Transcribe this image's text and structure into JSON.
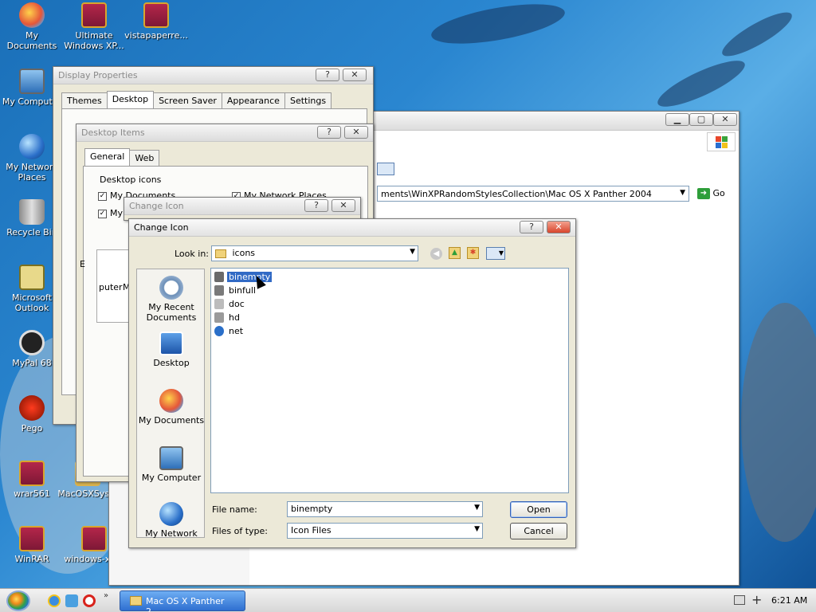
{
  "desktop": {
    "icons": [
      {
        "label": "My Documents",
        "icon": "apple-icon"
      },
      {
        "label": "Ultimate Windows XP...",
        "icon": "winrar-archive-icon"
      },
      {
        "label": "vistapaperre...",
        "icon": "winrar-archive-icon"
      },
      {
        "label": "My Computer",
        "icon": "monitor-icon"
      },
      {
        "label": "My Network Places",
        "icon": "globe-icon"
      },
      {
        "label": "Recycle Bin",
        "icon": "trash-icon"
      },
      {
        "label": "Microsoft Outlook",
        "icon": "outlook-icon"
      },
      {
        "label": "MyPal 68",
        "icon": "raccoon-icon"
      },
      {
        "label": "Pego",
        "icon": "pego-icon"
      },
      {
        "label": "wrar561",
        "icon": "winrar-archive-icon"
      },
      {
        "label": "MacOSXSys...",
        "icon": "folder-icon"
      },
      {
        "label": "WinRAR",
        "icon": "winrar-archive-icon"
      },
      {
        "label": "windows-xp...",
        "icon": "winrar-archive-icon"
      }
    ]
  },
  "explorer": {
    "address": "ments\\WinXPRandomStylesCollection\\Mac OS X Panther 2004",
    "go_label": "Go"
  },
  "display_properties": {
    "title": "Display Properties",
    "tabs": [
      "Themes",
      "Desktop",
      "Screen Saver",
      "Appearance",
      "Settings"
    ],
    "selected_tab": "Desktop"
  },
  "desktop_items": {
    "title": "Desktop Items",
    "tabs": [
      "General",
      "Web"
    ],
    "group_label": "Desktop icons",
    "checkboxes": [
      "My Documents",
      "My Network Places",
      "My"
    ],
    "partial_labels": [
      "E",
      "puter",
      "M"
    ]
  },
  "change_icon_bg": {
    "title": "Change Icon"
  },
  "change_icon": {
    "title": "Change Icon",
    "look_in_label": "Look in:",
    "look_in_value": "icons",
    "places": [
      "My Recent Documents",
      "Desktop",
      "My Documents",
      "My Computer",
      "My Network"
    ],
    "files": [
      {
        "name": "binempty",
        "selected": true,
        "color": "#6a6a6a"
      },
      {
        "name": "binfull",
        "selected": false,
        "color": "#7a7a7a"
      },
      {
        "name": "doc",
        "selected": false,
        "color": "#bcbcbc"
      },
      {
        "name": "hd",
        "selected": false,
        "color": "#9a9a9a"
      },
      {
        "name": "net",
        "selected": false,
        "color": "#2a6fc9"
      }
    ],
    "file_name_label": "File name:",
    "file_name_value": "binempty",
    "file_type_label": "Files of type:",
    "file_type_value": "Icon Files",
    "open_label": "Open",
    "cancel_label": "Cancel"
  },
  "taskbar": {
    "task_label": "Mac OS X Panther 2...",
    "clock": "6:21 AM"
  },
  "colors": {
    "selection": "#316ac5",
    "close_button": "#d8452c",
    "go_green": "#2e9e3a"
  }
}
